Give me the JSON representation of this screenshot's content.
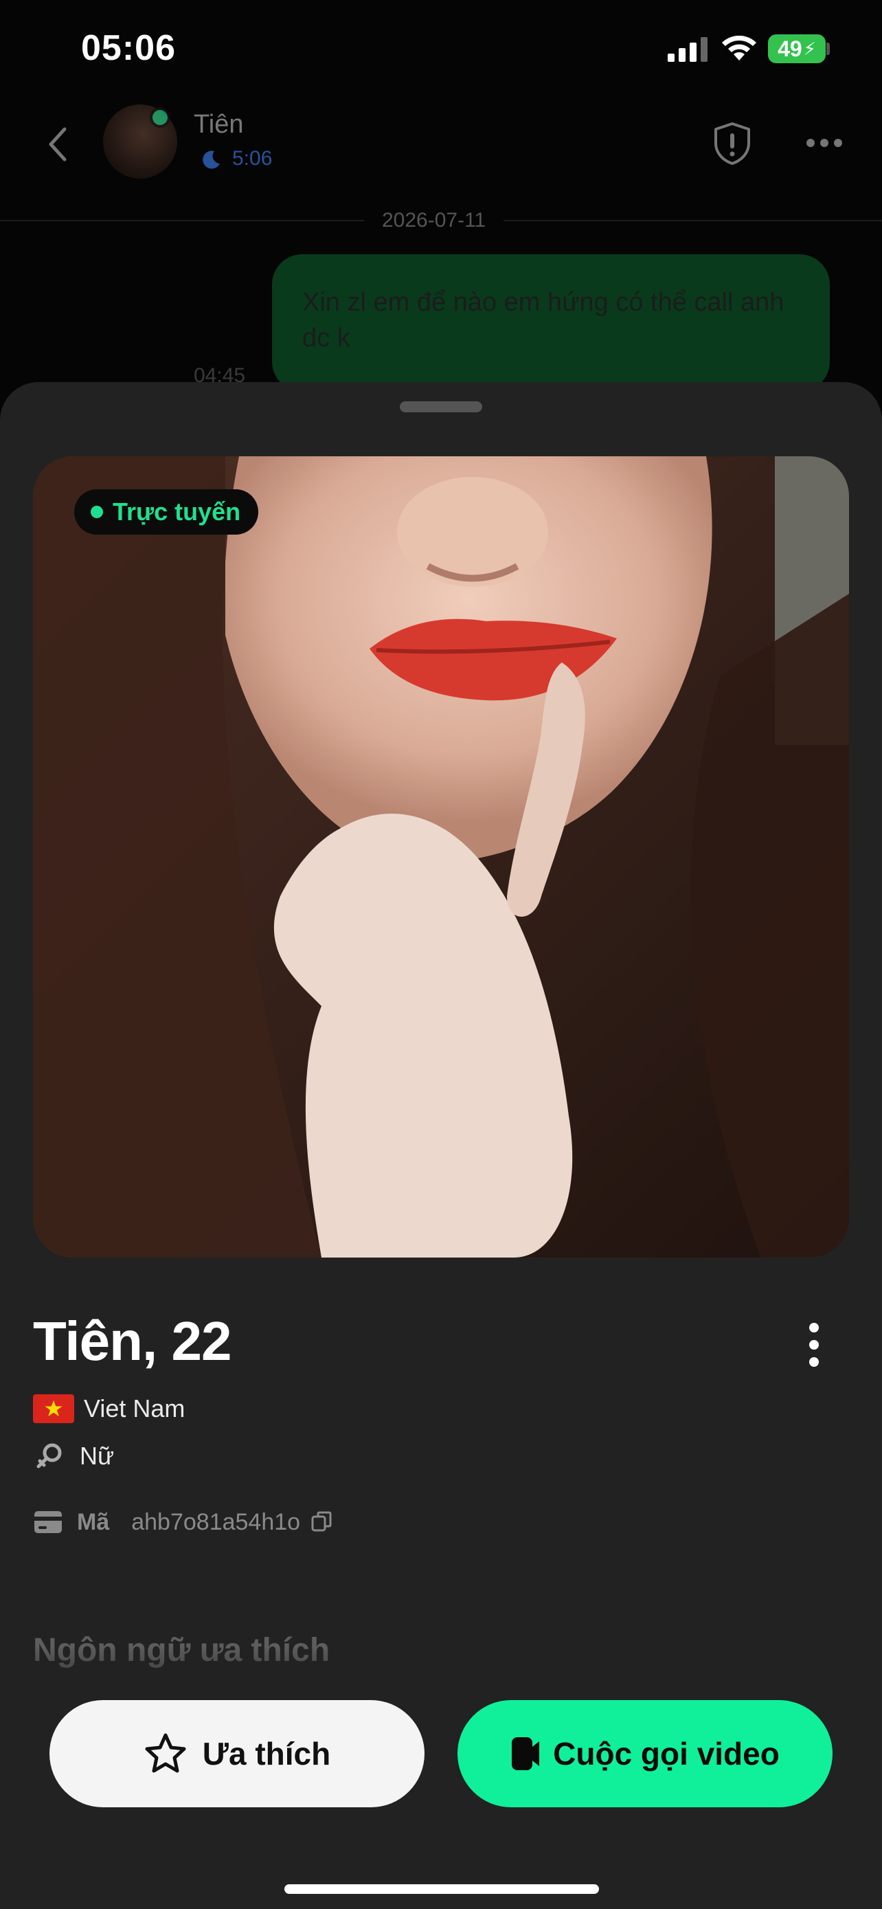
{
  "status_bar": {
    "time": "05:06",
    "battery": "49",
    "battery_color": "#32c24d"
  },
  "chat_header": {
    "contact_name": "Tiên",
    "contact_status_time": "5:06",
    "date_separator": "2026-07-11",
    "icons": [
      "back-arrow-icon",
      "shield-icon",
      "more-icon"
    ]
  },
  "messages": [
    {
      "text": "Xin zl em để nào em hứng có thể call anh dc k",
      "time": "04:45",
      "direction": "outgoing"
    }
  ],
  "profile": {
    "online_badge": "Trực tuyến",
    "name_age": "Tiên, 22",
    "country": "Viet Nam",
    "gender": "Nữ",
    "id_label": "Mã",
    "id_value": "ahb7o81a54h1o",
    "preferred_language_title": "Ngôn ngữ ưa thích"
  },
  "actions": {
    "like_label": "Ưa thích",
    "video_call_label": "Cuộc gọi video"
  },
  "colors": {
    "accent_green": "#10f09a",
    "online_green": "#1fe08f",
    "sheet_bg": "#222222",
    "bubble_bg": "#0a3a1c"
  }
}
